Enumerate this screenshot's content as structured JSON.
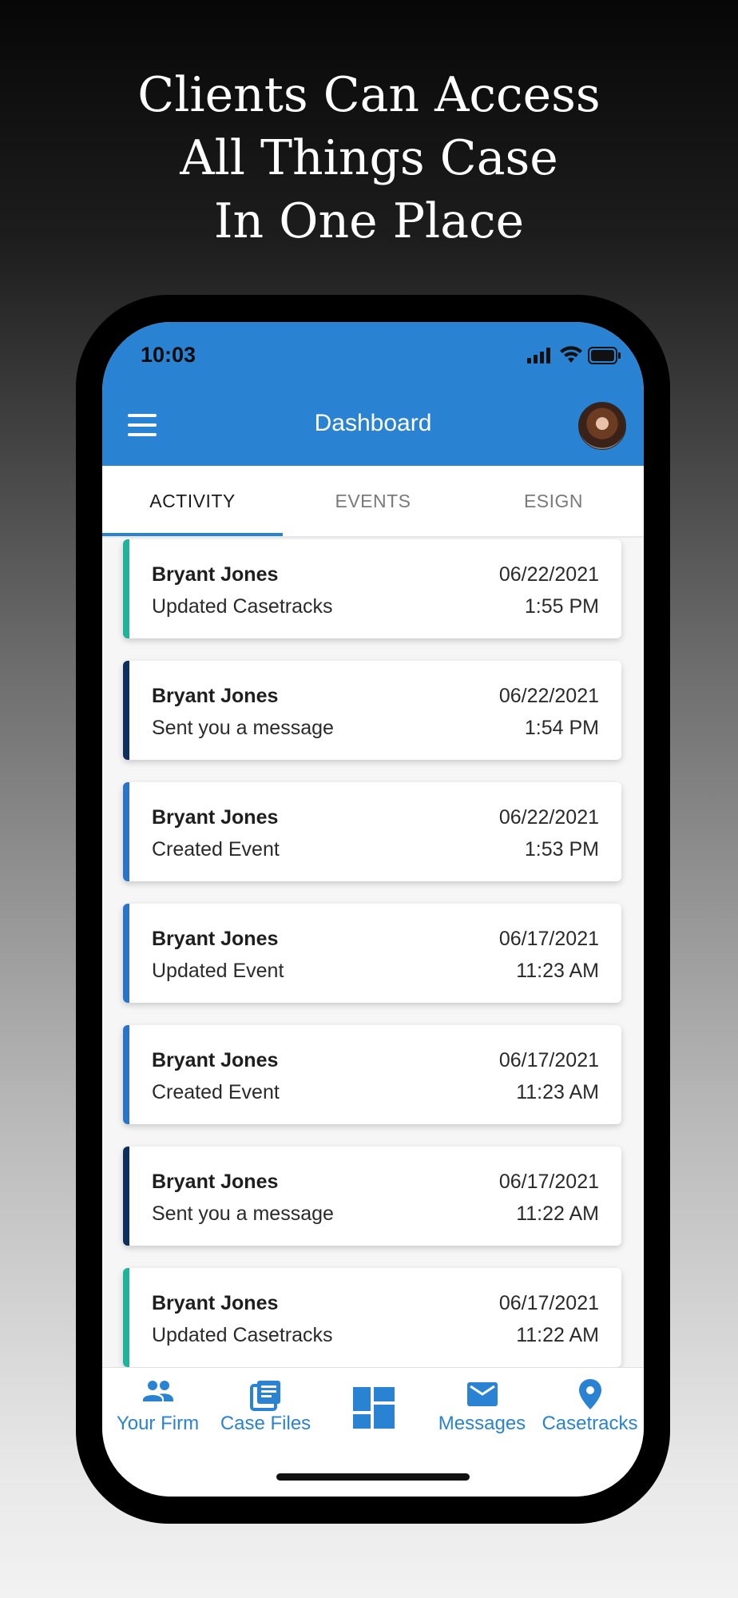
{
  "headline": {
    "line1": "Clients Can Access",
    "line2": "All Things Case",
    "line3": "In One Place"
  },
  "status_bar": {
    "time": "10:03"
  },
  "app_bar": {
    "title": "Dashboard"
  },
  "tabs": [
    {
      "label": "ACTIVITY",
      "active": true
    },
    {
      "label": "EVENTS",
      "active": false
    },
    {
      "label": "ESIGN",
      "active": false
    }
  ],
  "activity": [
    {
      "name": "Bryant Jones",
      "action": "Updated Casetracks",
      "date": "06/22/2021",
      "time": "1:55 PM",
      "accent": "#1fb39b"
    },
    {
      "name": "Bryant Jones",
      "action": "Sent you a message",
      "date": "06/22/2021",
      "time": "1:54 PM",
      "accent": "#0d2f5e"
    },
    {
      "name": "Bryant Jones",
      "action": "Created Event",
      "date": "06/22/2021",
      "time": "1:53 PM",
      "accent": "#2a74c8"
    },
    {
      "name": "Bryant Jones",
      "action": "Updated Event",
      "date": "06/17/2021",
      "time": "11:23 AM",
      "accent": "#2a74c8"
    },
    {
      "name": "Bryant Jones",
      "action": "Created Event",
      "date": "06/17/2021",
      "time": "11:23 AM",
      "accent": "#2a74c8"
    },
    {
      "name": "Bryant Jones",
      "action": "Sent you a message",
      "date": "06/17/2021",
      "time": "11:22 AM",
      "accent": "#0d2f5e"
    },
    {
      "name": "Bryant Jones",
      "action": "Updated Casetracks",
      "date": "06/17/2021",
      "time": "11:22 AM",
      "accent": "#1fb39b"
    }
  ],
  "bottom_nav": [
    {
      "label": "Your Firm",
      "icon": "people-icon"
    },
    {
      "label": "Case Files",
      "icon": "files-icon"
    },
    {
      "label": "",
      "icon": "dashboard-icon"
    },
    {
      "label": "Messages",
      "icon": "mail-icon"
    },
    {
      "label": "Casetracks",
      "icon": "location-pin-icon"
    }
  ],
  "colors": {
    "brand_blue": "#2a83d2",
    "teal": "#1fb39b",
    "navy": "#0d2f5e",
    "event_blue": "#2a74c8"
  }
}
